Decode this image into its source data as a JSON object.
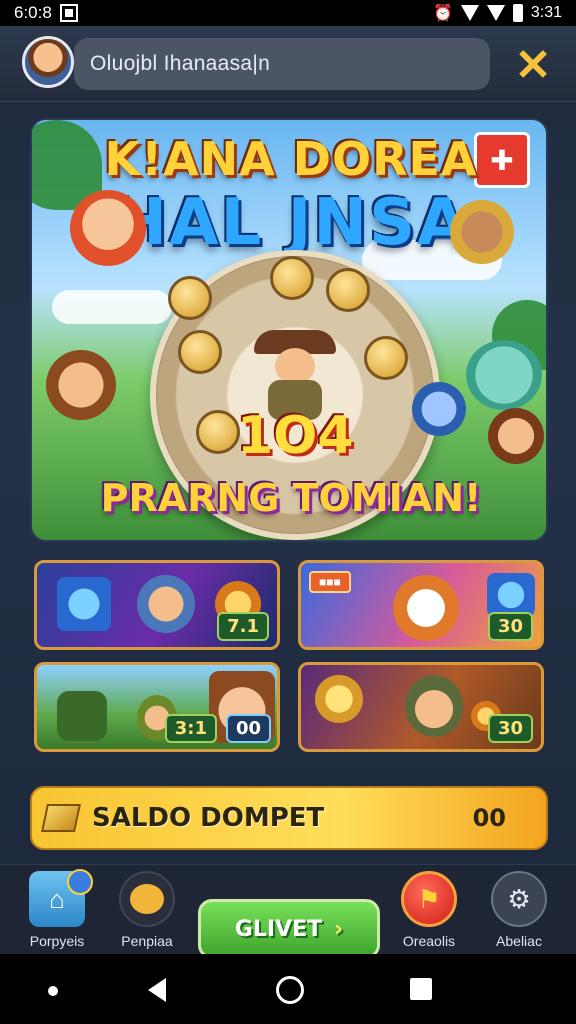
{
  "status_bar": {
    "time": "6:0:8",
    "right_text": "3:31"
  },
  "header": {
    "avatar_icon": "player-avatar",
    "search_text": "Oluojbl Ihanaasa|n",
    "close_icon": "close-x-icon"
  },
  "hero": {
    "title_line1": "K!ANA DOREA",
    "title_line2": "HAL JNSA",
    "number": "1O4",
    "cta": "PRARNG TOMIAN!"
  },
  "tiles": [
    {
      "badge": "7.1",
      "label": ""
    },
    {
      "badge": "30",
      "label": ""
    },
    {
      "badge": "3:1",
      "label": ""
    },
    {
      "badge": "30",
      "label": ""
    }
  ],
  "balance": {
    "label": "SALDO DOMPET",
    "value": "00"
  },
  "nav": {
    "items": [
      {
        "label": "Porpyeis",
        "icon": "home-icon"
      },
      {
        "label": "Penpiaa",
        "icon": "pet-icon"
      },
      {
        "label": "Oreaolis",
        "icon": "ticket-icon"
      },
      {
        "label": "Abeliac",
        "icon": "gear-icon"
      }
    ],
    "play_label": "GLIVET"
  },
  "colors": {
    "accent_yellow": "#ffd23a",
    "accent_green": "#3ea42e",
    "accent_red": "#d01e16"
  }
}
